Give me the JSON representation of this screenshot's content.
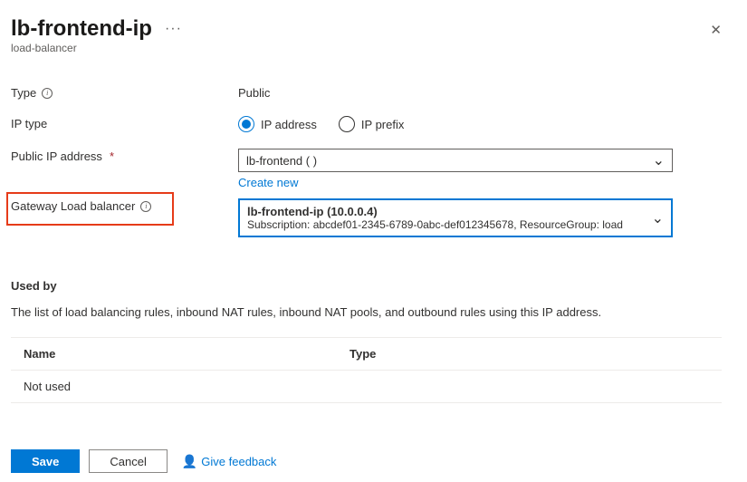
{
  "header": {
    "title": "lb-frontend-ip",
    "subtitle": "load-balancer"
  },
  "form": {
    "type": {
      "label": "Type",
      "value": "Public"
    },
    "ip_type": {
      "label": "IP type",
      "options": {
        "address": "IP address",
        "prefix": "IP prefix"
      },
      "selected": "address"
    },
    "public_ip": {
      "label": "Public IP address",
      "value": "lb-frontend (                       )",
      "create_new": "Create new"
    },
    "gateway_lb": {
      "label": "Gateway Load balancer",
      "line1": "lb-frontend-ip (10.0.0.4)",
      "line2": "Subscription: abcdef01-2345-6789-0abc-def012345678, ResourceGroup: load"
    }
  },
  "used_by": {
    "heading": "Used by",
    "description": "The list of load balancing rules, inbound NAT rules, inbound NAT pools, and outbound rules using this IP address.",
    "cols": {
      "name": "Name",
      "type": "Type"
    },
    "empty": "Not used"
  },
  "footer": {
    "save": "Save",
    "cancel": "Cancel",
    "feedback": "Give feedback"
  }
}
